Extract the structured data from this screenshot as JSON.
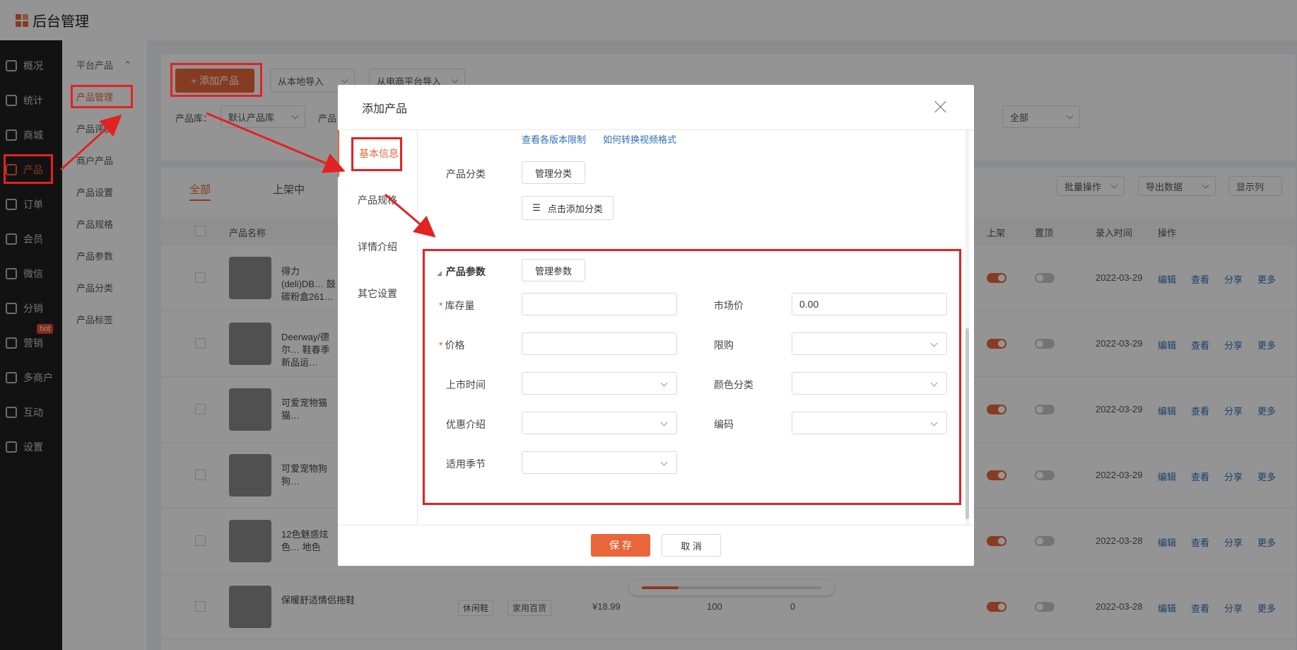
{
  "app": {
    "title": "后台管理"
  },
  "sidebar": {
    "items": [
      {
        "label": "概况",
        "icon": "layers-icon"
      },
      {
        "label": "统计",
        "icon": "chart-icon"
      },
      {
        "label": "商城",
        "icon": "store-icon"
      },
      {
        "label": "产品",
        "icon": "grid-icon"
      },
      {
        "label": "订单",
        "icon": "order-icon"
      },
      {
        "label": "会员",
        "icon": "crown-icon"
      },
      {
        "label": "微信",
        "icon": "wechat-icon"
      },
      {
        "label": "分销",
        "icon": "user-share-icon"
      },
      {
        "label": "营销",
        "icon": "flag-icon"
      },
      {
        "label": "多商户",
        "icon": "shop-icon"
      },
      {
        "label": "互动",
        "icon": "interact-icon"
      },
      {
        "label": "设置",
        "icon": "gear-icon"
      }
    ],
    "hot_badge": "hot"
  },
  "subsidebar": {
    "group1": "平台产品",
    "items": [
      "产品管理",
      "产品评价",
      "商户产品",
      "产品设置",
      "产品规格",
      "产品参数",
      "产品分类",
      "产品标签"
    ]
  },
  "toolbar": {
    "add_product": "+ 添加产品",
    "import_local": "从本地导入",
    "import_ecommerce": "从电商平台导入",
    "library_label": "产品库：",
    "library_value": "默认产品库",
    "category_label_partial": "产品",
    "all_filter": "全部"
  },
  "table": {
    "tabs": [
      "全部",
      "上架中"
    ],
    "batch": "批量操作",
    "export": "导出数据",
    "columns_btn": "显示列",
    "headers": {
      "name": "产品名称",
      "on_shelf": "上架",
      "top": "置顶",
      "entry_time": "录入时间",
      "actions": "操作"
    },
    "rows": [
      {
        "name": "得力(deli)DB… 鼓 碳粉盒261…",
        "date": "2022-03-29",
        "on": true
      },
      {
        "name": "Deerway/德尔… 鞋春季新品运…",
        "date": "2022-03-29",
        "on": true
      },
      {
        "name": "可爱宠物猫猫…",
        "date": "2022-03-29",
        "on": true
      },
      {
        "name": "可爱宠物狗狗…",
        "date": "2022-03-29",
        "on": true
      },
      {
        "name": "12色魅惑炫色… 地色",
        "date": "2022-03-28",
        "on": true
      },
      {
        "name": "保暖舒适情侣拖鞋",
        "date": "2022-03-28",
        "on": true,
        "tags": [
          "休闲鞋",
          "家用百货"
        ],
        "price": "¥18.99",
        "stock": "100",
        "sales": "0"
      }
    ],
    "ops": [
      "编辑",
      "查看",
      "分享",
      "更多"
    ]
  },
  "modal": {
    "title": "添加产品",
    "nav": [
      "基本信息",
      "产品规格",
      "详情介绍",
      "其它设置"
    ],
    "links": [
      "查看各版本限制",
      "如何转换视频格式"
    ],
    "category_label": "产品分类",
    "manage_category": "管理分类",
    "add_category": "点击添加分类",
    "params_title": "产品参数",
    "manage_params": "管理参数",
    "fields": {
      "stock": {
        "label": "库存量",
        "value": ""
      },
      "market_price": {
        "label": "市场价",
        "value": "0.00"
      },
      "price": {
        "label": "价格",
        "value": ""
      },
      "limit": {
        "label": "限购",
        "value": ""
      },
      "launch_time": {
        "label": "上市时间",
        "value": ""
      },
      "color": {
        "label": "颜色分类",
        "value": ""
      },
      "promo": {
        "label": "优惠介绍",
        "value": ""
      },
      "code": {
        "label": "编码",
        "value": ""
      },
      "season": {
        "label": "适用季节",
        "value": ""
      }
    },
    "required_mark": "*",
    "save": "保 存",
    "cancel": "取 消"
  },
  "colors": {
    "accent": "#e8663a",
    "annotation": "#e32222",
    "link": "#2d6fb6"
  }
}
